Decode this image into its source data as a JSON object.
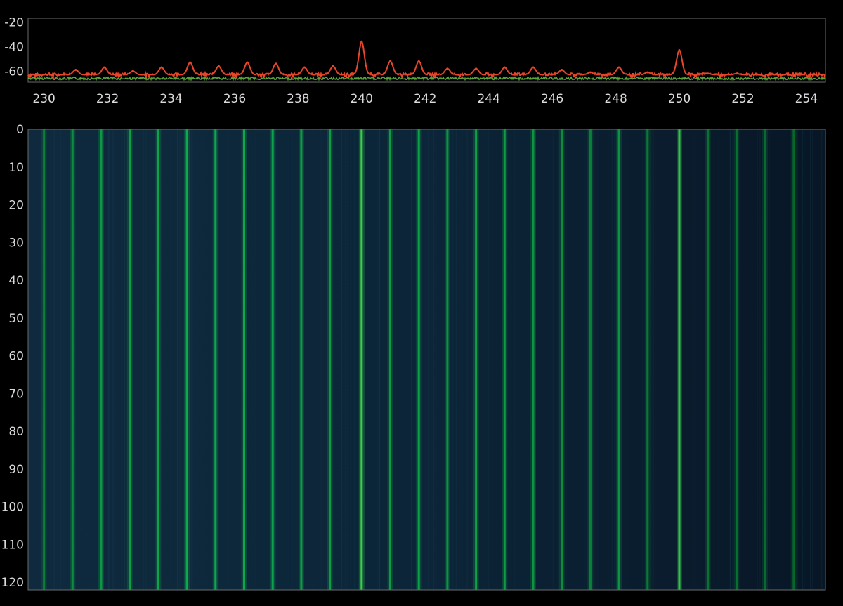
{
  "colors": {
    "background": "#000000",
    "spectrum_trace": "#e8452a",
    "spectrum_floor": "#6fd04a",
    "waterfall_low": "#0a1a2c",
    "waterfall_high": "#3cf08a",
    "axis_frame": "#6a6a6a"
  },
  "chart_data": [
    {
      "type": "line",
      "name_hint": "spectrum",
      "xlabel": "",
      "ylabel": "",
      "xlim": [
        229.5,
        254.6
      ],
      "ylim": [
        -69,
        -17
      ],
      "x_ticks": [
        "230",
        "232",
        "234",
        "236",
        "238",
        "240",
        "242",
        "244",
        "246",
        "248",
        "250",
        "252",
        "254"
      ],
      "y_ticks": [
        "-20",
        "-40",
        "-60"
      ],
      "grid": false,
      "noise_floor_db": -63,
      "peaks": [
        {
          "x": 230.3,
          "y": -66
        },
        {
          "x": 231.0,
          "y": -59
        },
        {
          "x": 231.9,
          "y": -57
        },
        {
          "x": 232.8,
          "y": -60
        },
        {
          "x": 233.7,
          "y": -57
        },
        {
          "x": 234.6,
          "y": -53
        },
        {
          "x": 235.5,
          "y": -56
        },
        {
          "x": 236.4,
          "y": -53
        },
        {
          "x": 237.3,
          "y": -54
        },
        {
          "x": 238.2,
          "y": -57
        },
        {
          "x": 239.1,
          "y": -56
        },
        {
          "x": 240.0,
          "y": -36
        },
        {
          "x": 240.9,
          "y": -52
        },
        {
          "x": 241.8,
          "y": -52
        },
        {
          "x": 242.7,
          "y": -58
        },
        {
          "x": 243.6,
          "y": -58
        },
        {
          "x": 244.5,
          "y": -57
        },
        {
          "x": 245.4,
          "y": -57
        },
        {
          "x": 246.3,
          "y": -59
        },
        {
          "x": 247.2,
          "y": -61
        },
        {
          "x": 248.1,
          "y": -57
        },
        {
          "x": 249.0,
          "y": -61
        },
        {
          "x": 250.0,
          "y": -43
        },
        {
          "x": 250.9,
          "y": -62
        },
        {
          "x": 251.8,
          "y": -62
        },
        {
          "x": 252.7,
          "y": -64
        },
        {
          "x": 253.6,
          "y": -64
        }
      ]
    },
    {
      "type": "heatmap",
      "name_hint": "waterfall",
      "xlim": [
        229.5,
        254.6
      ],
      "ylim": [
        0,
        122
      ],
      "y_ticks": [
        "0",
        "10",
        "20",
        "30",
        "40",
        "50",
        "60",
        "70",
        "80",
        "90",
        "100",
        "110",
        "120"
      ],
      "grid": false,
      "lines": [
        {
          "x": 230.0,
          "intensity": 0.25
        },
        {
          "x": 230.9,
          "intensity": 0.35
        },
        {
          "x": 231.8,
          "intensity": 0.45
        },
        {
          "x": 232.7,
          "intensity": 0.5
        },
        {
          "x": 233.6,
          "intensity": 0.55
        },
        {
          "x": 234.5,
          "intensity": 0.6
        },
        {
          "x": 235.4,
          "intensity": 0.6
        },
        {
          "x": 236.3,
          "intensity": 0.6
        },
        {
          "x": 237.2,
          "intensity": 0.55
        },
        {
          "x": 238.1,
          "intensity": 0.5
        },
        {
          "x": 239.0,
          "intensity": 0.5
        },
        {
          "x": 240.0,
          "intensity": 1.0
        },
        {
          "x": 240.9,
          "intensity": 0.5
        },
        {
          "x": 241.8,
          "intensity": 0.55
        },
        {
          "x": 242.7,
          "intensity": 0.45
        },
        {
          "x": 243.6,
          "intensity": 0.55
        },
        {
          "x": 244.5,
          "intensity": 0.5
        },
        {
          "x": 245.4,
          "intensity": 0.45
        },
        {
          "x": 246.3,
          "intensity": 0.4
        },
        {
          "x": 247.2,
          "intensity": 0.3
        },
        {
          "x": 248.1,
          "intensity": 0.45
        },
        {
          "x": 249.0,
          "intensity": 0.25
        },
        {
          "x": 250.0,
          "intensity": 0.85
        },
        {
          "x": 250.9,
          "intensity": 0.2
        },
        {
          "x": 251.8,
          "intensity": 0.18
        },
        {
          "x": 252.7,
          "intensity": 0.15
        },
        {
          "x": 253.6,
          "intensity": 0.12
        }
      ]
    }
  ]
}
